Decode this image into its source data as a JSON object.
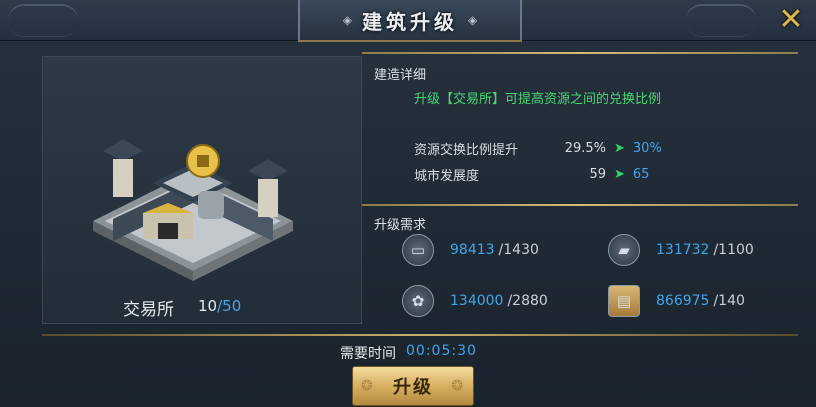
{
  "window": {
    "title": "建筑升级"
  },
  "building": {
    "name": "交易所",
    "level": "10",
    "max_level": "/50"
  },
  "details": {
    "section_title": "建造详细",
    "description": "升级【交易所】可提高资源之间的兑换比例",
    "stats": [
      {
        "label": "资源交换比例提升",
        "old": "29.5%",
        "arrow": "➤",
        "new": "30%"
      },
      {
        "label": "城市发展度",
        "old": "59",
        "arrow": "➤",
        "new": "65"
      }
    ]
  },
  "requirements": {
    "section_title": "升级需求",
    "items": [
      {
        "icon": "wood-log-icon",
        "have": "98413",
        "need": "/1430"
      },
      {
        "icon": "stone-block-icon",
        "have": "131732",
        "need": "/1100"
      },
      {
        "icon": "food-grain-icon",
        "have": "134000",
        "need": "/2880"
      },
      {
        "icon": "scroll-icon",
        "have": "866975",
        "need": "/140"
      }
    ]
  },
  "time": {
    "label": "需要时间",
    "value": "00:05:30"
  },
  "actions": {
    "upgrade_label": "升级",
    "close_symbol": "✕"
  },
  "colors": {
    "accent_blue": "#3fa6ec",
    "accent_green": "#46d873",
    "gold": "#d6bb7a"
  }
}
